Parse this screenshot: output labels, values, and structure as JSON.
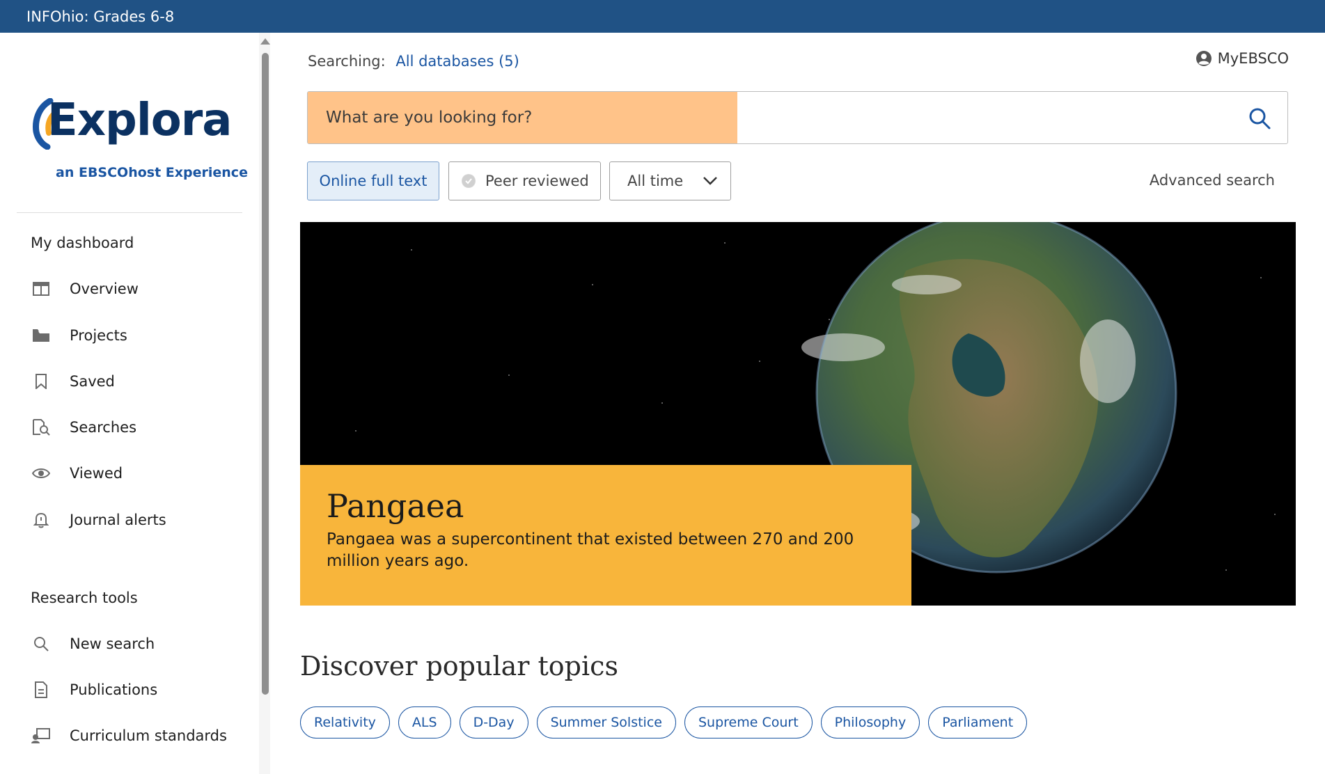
{
  "header": {
    "title": "INFOhio: Grades 6-8"
  },
  "brand": {
    "name": "Explora",
    "tagline": "an EBSCOhost Experience",
    "color_dark": "#0b3161",
    "color_blue": "#1a55a2",
    "accent_orange": "#f5a623"
  },
  "sidebar": {
    "dashboard_title": "My dashboard",
    "dashboard_items": [
      {
        "label": "Overview",
        "icon": "overview-icon"
      },
      {
        "label": "Projects",
        "icon": "folder-icon"
      },
      {
        "label": "Saved",
        "icon": "bookmark-icon"
      },
      {
        "label": "Searches",
        "icon": "search-history-icon"
      },
      {
        "label": "Viewed",
        "icon": "eye-icon"
      },
      {
        "label": "Journal alerts",
        "icon": "bell-icon"
      }
    ],
    "tools_title": "Research tools",
    "tools_items": [
      {
        "label": "New search",
        "icon": "search-icon"
      },
      {
        "label": "Publications",
        "icon": "document-icon"
      },
      {
        "label": "Curriculum standards",
        "icon": "standards-icon"
      }
    ]
  },
  "search": {
    "searching_label": "Searching:",
    "databases_link": "All databases (5)",
    "placeholder": "What are you looking for?",
    "value": "",
    "account_label": "MyEBSCO"
  },
  "filters": {
    "full_text": "Online full text",
    "peer_reviewed": "Peer reviewed",
    "date_range": "All time",
    "advanced": "Advanced search"
  },
  "hero": {
    "title": "Pangaea",
    "description": "Pangaea was a supercontinent that existed between 270 and 200 million years ago.",
    "caption_color": "#f8b53b"
  },
  "discover": {
    "title": "Discover popular topics",
    "topics": [
      "Relativity",
      "ALS",
      "D-Day",
      "Summer Solstice",
      "Supreme Court",
      "Philosophy",
      "Parliament"
    ]
  }
}
